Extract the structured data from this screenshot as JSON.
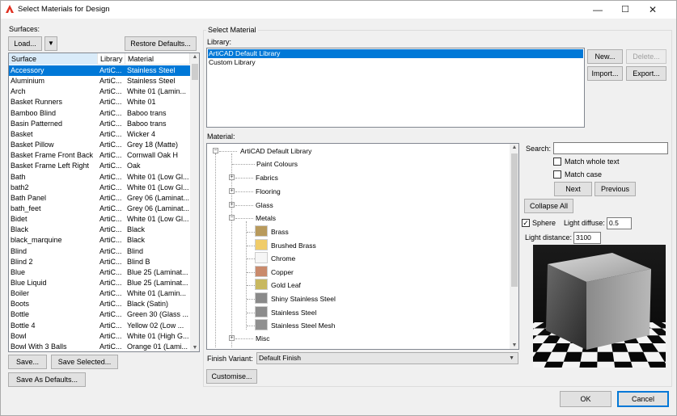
{
  "window": {
    "title": "Select Materials for Design",
    "minimize": "—",
    "maximize": "☐",
    "close": "✕"
  },
  "surfaces": {
    "label": "Surfaces:",
    "load_label": "Load...",
    "dropdown_arrow": "▼",
    "restore_label": "Restore Defaults...",
    "columns": [
      "Surface",
      "Library",
      "Material"
    ],
    "rows": [
      {
        "surface": "Accessory",
        "library": "ArtiC...",
        "material": "Stainless Steel",
        "selected": true
      },
      {
        "surface": "Aluminium",
        "library": "ArtiC...",
        "material": "Stainless Steel"
      },
      {
        "surface": "Arch",
        "library": "ArtiC...",
        "material": "White 01 (Lamin..."
      },
      {
        "surface": "Basket Runners",
        "library": "ArtiC...",
        "material": "White 01"
      },
      {
        "surface": "Bamboo Blind",
        "library": "ArtiC...",
        "material": "Baboo trans"
      },
      {
        "surface": "Basin Patterned",
        "library": "ArtiC...",
        "material": "Baboo trans"
      },
      {
        "surface": "Basket",
        "library": "ArtiC...",
        "material": "Wicker 4"
      },
      {
        "surface": "Basket Pillow",
        "library": "ArtiC...",
        "material": "Grey 18 (Matte)"
      },
      {
        "surface": "Basket Frame Front Back",
        "library": "ArtiC...",
        "material": "Cornwall Oak H"
      },
      {
        "surface": "Basket Frame Left Right",
        "library": "ArtiC...",
        "material": " Oak"
      },
      {
        "surface": "Bath",
        "library": "ArtiC...",
        "material": "White 01 (Low Gl..."
      },
      {
        "surface": "bath2",
        "library": "ArtiC...",
        "material": "White 01 (Low Gl..."
      },
      {
        "surface": "Bath Panel",
        "library": "ArtiC...",
        "material": "Grey 06 (Laminat..."
      },
      {
        "surface": "bath_feet",
        "library": "ArtiC...",
        "material": "Grey 06 (Laminat..."
      },
      {
        "surface": "Bidet",
        "library": "ArtiC...",
        "material": "White 01 (Low Gl..."
      },
      {
        "surface": "Black",
        "library": "ArtiC...",
        "material": "Black"
      },
      {
        "surface": "black_marquine",
        "library": "ArtiC...",
        "material": "Black"
      },
      {
        "surface": "Blind",
        "library": "ArtiC...",
        "material": "Blind"
      },
      {
        "surface": "Blind 2",
        "library": "ArtiC...",
        "material": "Blind B"
      },
      {
        "surface": "Blue",
        "library": "ArtiC...",
        "material": "Blue 25 (Laminat..."
      },
      {
        "surface": "Blue Liquid",
        "library": "ArtiC...",
        "material": "Blue 25 (Laminat..."
      },
      {
        "surface": "Boiler",
        "library": "ArtiC...",
        "material": "White 01 (Lamin..."
      },
      {
        "surface": "Boots",
        "library": "ArtiC...",
        "material": "Black (Satin)"
      },
      {
        "surface": "Bottle",
        "library": "ArtiC...",
        "material": "Green 30 (Glass ..."
      },
      {
        "surface": "Bottle 4",
        "library": "ArtiC...",
        "material": "Yellow 02 (Low ..."
      },
      {
        "surface": "Bowl",
        "library": "ArtiC...",
        "material": "White 01 (High G..."
      },
      {
        "surface": "Bowl With 3 Balls",
        "library": "ArtiC...",
        "material": "Orange 01 (Lami..."
      }
    ],
    "save_label": "Save...",
    "save_selected_label": "Save Selected...",
    "save_defaults_label": "Save As Defaults..."
  },
  "select_material": {
    "group_label": "Select Material",
    "library_label": "Library:",
    "libraries": [
      {
        "name": "ArtiCAD Default Library",
        "selected": true
      },
      {
        "name": "Custom Library"
      }
    ],
    "new_label": "New...",
    "delete_label": "Delete...",
    "import_label": "Import...",
    "export_label": "Export...",
    "material_label": "Material:",
    "tree_root": "ArtiCAD Default Library",
    "tree_categories": [
      "Paint Colours",
      "Fabrics",
      "Flooring",
      "Glass",
      "Metals"
    ],
    "metals": [
      {
        "name": "Brass",
        "color": "#b89a5c"
      },
      {
        "name": "Brushed Brass",
        "color": "#f0cc6a"
      },
      {
        "name": "Chrome",
        "color": "#f6f6f6"
      },
      {
        "name": "Copper",
        "color": "#c98a6c"
      },
      {
        "name": "Gold Leaf",
        "color": "#c8b860"
      },
      {
        "name": "Shiny Stainless Steel",
        "color": "#8a8a8a"
      },
      {
        "name": "Stainless Steel",
        "color": "#8c8c8c"
      },
      {
        "name": "Stainless Steel Mesh",
        "color": "#909090"
      }
    ],
    "tree_after": "Misc",
    "finish_variant_label": "Finish Variant:",
    "finish_variant_value": "Default Finish",
    "customise_label": "Customise..."
  },
  "search": {
    "label": "Search:",
    "value": "",
    "match_whole_text": "Match whole text",
    "match_case": "Match case",
    "next_label": "Next",
    "previous_label": "Previous",
    "collapse_all_label": "Collapse All"
  },
  "preview": {
    "sphere_label": "Sphere",
    "sphere_checked": true,
    "light_diffuse_label": "Light diffuse:",
    "light_diffuse_value": "0.5",
    "light_distance_label": "Light distance:",
    "light_distance_value": "3100"
  },
  "footer": {
    "ok_label": "OK",
    "cancel_label": "Cancel"
  }
}
